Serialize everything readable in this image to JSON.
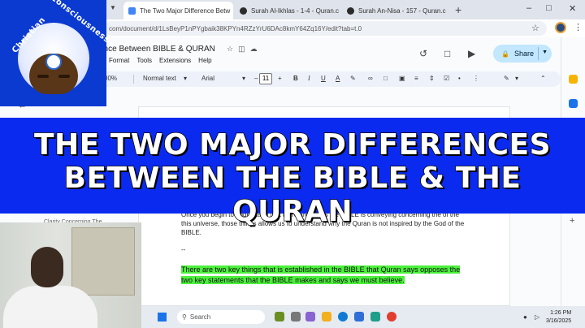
{
  "browser": {
    "tabs": [
      {
        "title": "The Two Major Difference Betw",
        "active": true,
        "favicon_color": "#4285f4"
      },
      {
        "title": "Surah Al-Ikhlas - 1-4 - Quran.c",
        "active": false,
        "favicon_color": "#2b2b2b"
      },
      {
        "title": "Surah An-Nisa - 157 - Quran.c",
        "active": false,
        "favicon_color": "#2b2b2b"
      }
    ],
    "new_tab_icon": "+",
    "url": "com/document/d/1LsBeyP1nPYgbaik38KPYn4RZzYrU6DAc8kmY64Zq16Y/edit?tab=t.0"
  },
  "docs": {
    "title": "ence Between BIBLE & QURAN",
    "menus": [
      "Format",
      "Tools",
      "Extensions",
      "Help"
    ],
    "share_label": "Share",
    "toolbar": {
      "zoom": "00%",
      "style": "Normal text",
      "font": "Arial",
      "font_size": "11"
    }
  },
  "document": {
    "outline_item": "Clarity Concerning The",
    "paragraph_1": "Once you begin to understand that there are things the BIBLE is conveying concerning the of the this universe, those things allows us to understand why the Quran is not inspired by the God of the BIBLE.",
    "separator": "--",
    "highlighted": "There are two key things that is established in the BIBLE that Quran says opposes the two key statements that the BIBLE makes and says we must believe."
  },
  "banner": {
    "line1": "THE TWO MAJOR DIFFERENCES",
    "line2": "BETWEEN THE BIBLE & THE QURAN"
  },
  "logo": {
    "text_left": "Christian",
    "text_right": "Consciousness"
  },
  "taskbar": {
    "search_label": "Search",
    "time": "1:26 PM",
    "date": "3/16/2025"
  },
  "colors": {
    "banner": "#0a2af0",
    "highlight": "#4cf03c",
    "share_button": "#c2e7ff"
  }
}
